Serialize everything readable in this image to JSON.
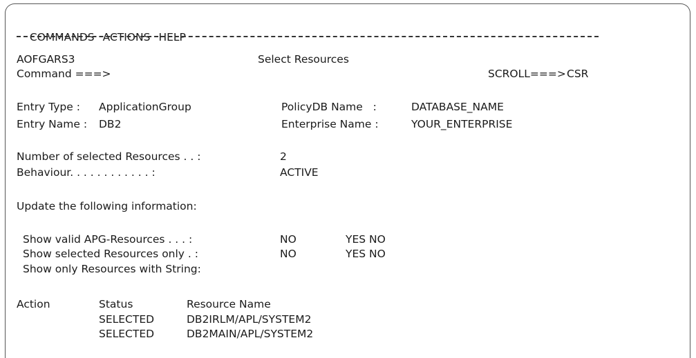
{
  "menu": [
    "COMMANDS",
    "ACTIONS",
    "HELP"
  ],
  "panel": {
    "id": "AOFGARS3",
    "title": "Select Resources",
    "command_label": "Command ===>",
    "command_value": "",
    "scroll_label": "SCROLL===>",
    "scroll_value": "CSR"
  },
  "entry": {
    "type_label": "Entry Type :",
    "type_value": "ApplicationGroup",
    "name_label": "Entry Name :",
    "name_value": "DB2",
    "policydb_label": "PolicyDB Name   :",
    "policydb_value": "DATABASE_NAME",
    "enterprise_label": "Enterprise Name :",
    "enterprise_value": "YOUR_ENTERPRISE"
  },
  "summary": {
    "selected_label": "Number of selected Resources . . :",
    "selected_value": "2",
    "behaviour_label": "Behaviour. . . . . . . . . . . . :",
    "behaviour_value": "ACTIVE"
  },
  "update_heading": "Update the following information:",
  "options": [
    {
      "label": "Show valid APG-Resources . . . :",
      "value": "NO",
      "choices": "YES NO"
    },
    {
      "label": "Show selected Resources only . :",
      "value": "NO",
      "choices": "YES NO"
    },
    {
      "label": "Show only Resources with String:",
      "value": "",
      "choices": ""
    }
  ],
  "table": {
    "headers": [
      "Action",
      "Status",
      "Resource Name"
    ],
    "rows": [
      {
        "action": "",
        "status": "SELECTED",
        "resource": "DB2IRLM/APL/SYSTEM2"
      },
      {
        "action": "",
        "status": "SELECTED",
        "resource": "DB2MAIN/APL/SYSTEM2"
      }
    ]
  }
}
